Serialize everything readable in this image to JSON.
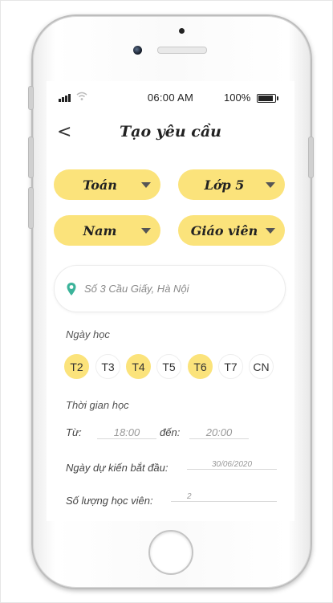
{
  "status": {
    "time": "06:00 AM",
    "battery": "100%"
  },
  "header": {
    "title": "Tạo yêu cầu",
    "back": "<"
  },
  "filters": [
    {
      "label": "Toán"
    },
    {
      "label": "Lớp 5"
    },
    {
      "label": "Nam"
    },
    {
      "label": "Giáo viên"
    }
  ],
  "address": {
    "value": "Số 3 Cầu Giấy, Hà Nội"
  },
  "days_label": "Ngày học",
  "days": [
    {
      "label": "T2",
      "selected": true
    },
    {
      "label": "T3",
      "selected": false
    },
    {
      "label": "T4",
      "selected": true
    },
    {
      "label": "T5",
      "selected": false
    },
    {
      "label": "T6",
      "selected": true
    },
    {
      "label": "T7",
      "selected": false
    },
    {
      "label": "CN",
      "selected": false
    }
  ],
  "time_label": "Thời gian học",
  "time_range": {
    "from_label": "Từ:",
    "from": "18:00",
    "to_label": "đến:",
    "to": "20:00"
  },
  "start_date": {
    "label": "Ngày dự kiến bắt đầu:",
    "value": "30/06/2020"
  },
  "students": {
    "label": "Số lượng học viên:",
    "value": "2"
  },
  "colors": {
    "accent": "#fbe37b",
    "pin": "#3bb39a"
  },
  "icons": [
    "signal-icon",
    "wifi-icon",
    "battery-icon",
    "back-icon",
    "dropdown-arrow-icon",
    "location-pin-icon"
  ]
}
